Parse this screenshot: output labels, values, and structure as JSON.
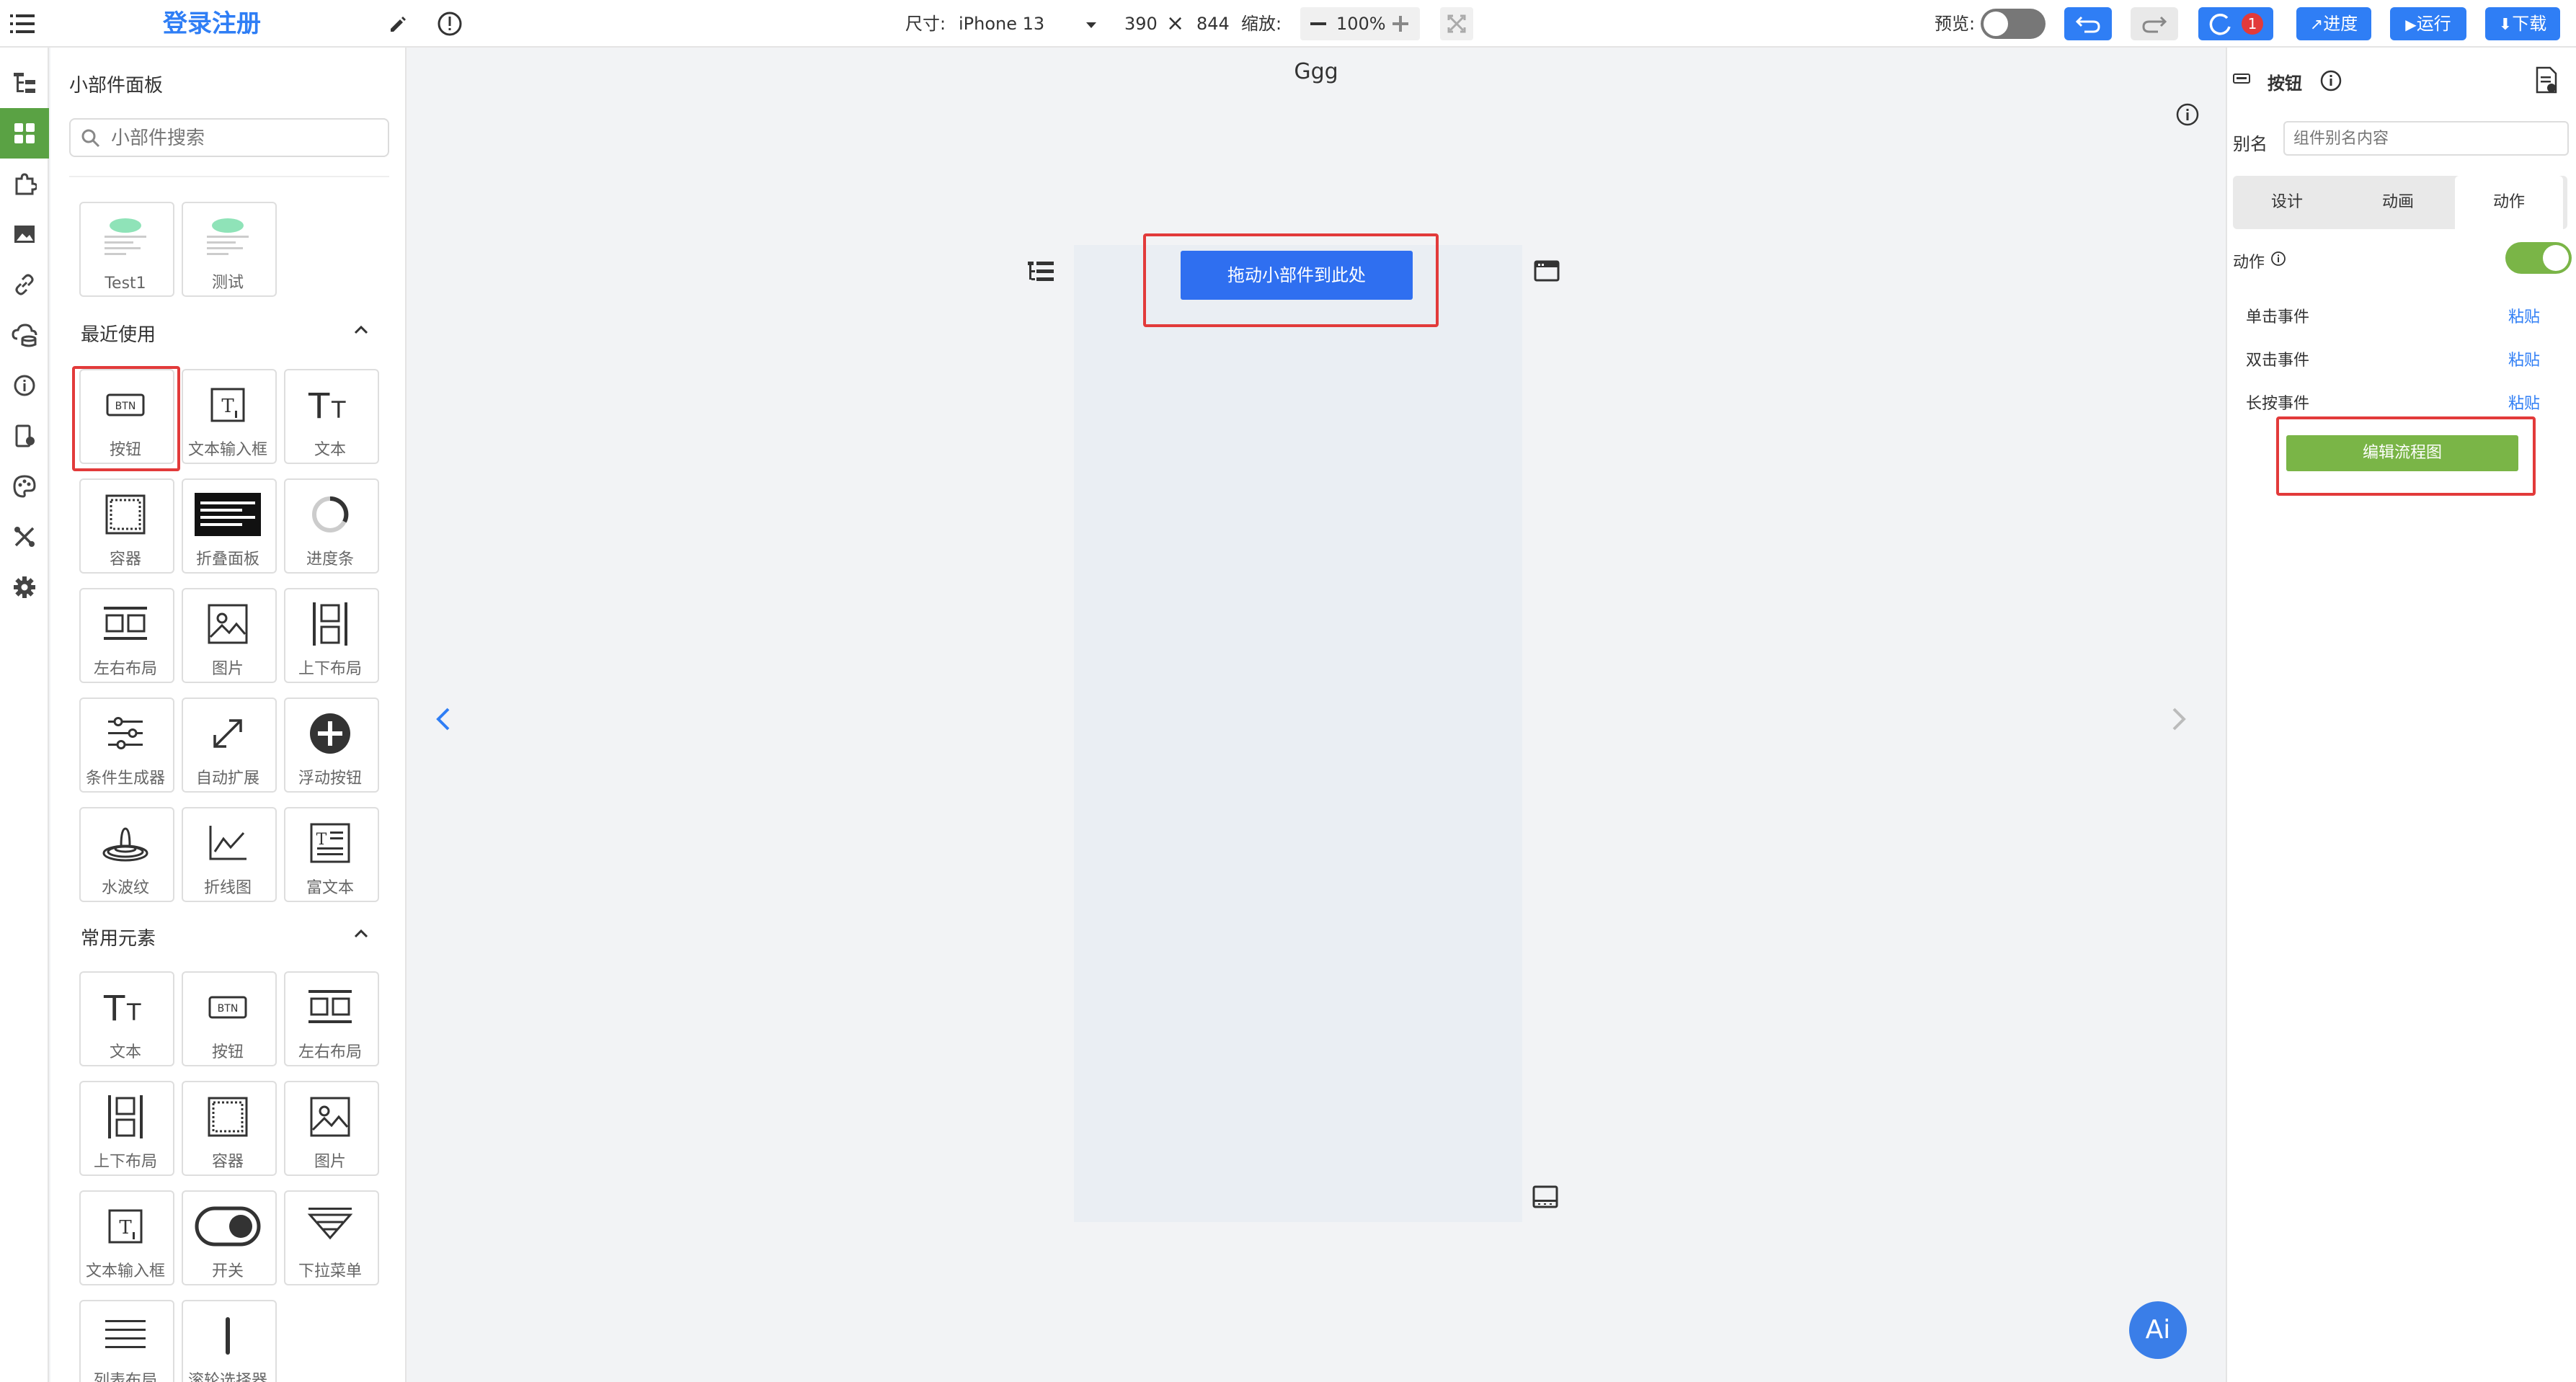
{
  "header": {
    "app_title": "登录注册",
    "size_label": "尺寸:",
    "device": "iPhone 13",
    "width": "390",
    "height": "844",
    "zoom_label": "缩放:",
    "zoom": "100%",
    "preview_label": "预览:",
    "notification_count": "1",
    "progress_button": "进度",
    "run_button": "运行",
    "download_button": "下载"
  },
  "widget_panel": {
    "title": "小部件面板",
    "search_placeholder": "小部件搜索",
    "templates": [
      {
        "label": "Test1"
      },
      {
        "label": "测试"
      }
    ],
    "recent_title": "最近使用",
    "recent": [
      {
        "label": "按钮",
        "icon": "btn-icon"
      },
      {
        "label": "文本输入框",
        "icon": "text-input-icon"
      },
      {
        "label": "文本",
        "icon": "text-icon"
      },
      {
        "label": "容器",
        "icon": "container-icon"
      },
      {
        "label": "折叠面板",
        "icon": "accordion-icon"
      },
      {
        "label": "进度条",
        "icon": "progress-icon"
      },
      {
        "label": "左右布局",
        "icon": "row-layout-icon"
      },
      {
        "label": "图片",
        "icon": "image-icon"
      },
      {
        "label": "上下布局",
        "icon": "column-layout-icon"
      },
      {
        "label": "条件生成器",
        "icon": "sliders-icon"
      },
      {
        "label": "自动扩展",
        "icon": "expand-icon"
      },
      {
        "label": "浮动按钮",
        "icon": "plus-circle-icon"
      },
      {
        "label": "水波纹",
        "icon": "ripple-icon"
      },
      {
        "label": "折线图",
        "icon": "line-chart-icon"
      },
      {
        "label": "富文本",
        "icon": "rich-text-icon"
      }
    ],
    "common_title": "常用元素",
    "common": [
      {
        "label": "文本",
        "icon": "text-icon"
      },
      {
        "label": "按钮",
        "icon": "btn-icon"
      },
      {
        "label": "左右布局",
        "icon": "row-layout-icon"
      },
      {
        "label": "上下布局",
        "icon": "column-layout-icon"
      },
      {
        "label": "容器",
        "icon": "container-icon"
      },
      {
        "label": "图片",
        "icon": "image-icon"
      },
      {
        "label": "文本输入框",
        "icon": "text-input-icon"
      },
      {
        "label": "开关",
        "icon": "switch-icon"
      },
      {
        "label": "下拉菜单",
        "icon": "dropdown-icon"
      },
      {
        "label": "列表布局",
        "icon": "list-icon"
      },
      {
        "label": "滚轮选择器",
        "icon": "wheel-icon"
      }
    ]
  },
  "canvas": {
    "page_name": "Ggg",
    "drop_button": "拖动小部件到此处",
    "ai_label": "Ai"
  },
  "inspector": {
    "component_type": "按钮",
    "alias_label": "别名",
    "alias_placeholder": "组件别名内容",
    "tabs": [
      "设计",
      "动画",
      "动作"
    ],
    "action_label": "动作",
    "events": [
      {
        "label": "单击事件",
        "action": "粘贴"
      },
      {
        "label": "双击事件",
        "action": "粘贴"
      },
      {
        "label": "长按事件",
        "action": "粘贴"
      }
    ],
    "edit_flow_button": "编辑流程图"
  },
  "colors": {
    "accent_blue": "#2f7ef5",
    "accent_green": "#7ab547",
    "highlight_red": "#e23a3a"
  }
}
